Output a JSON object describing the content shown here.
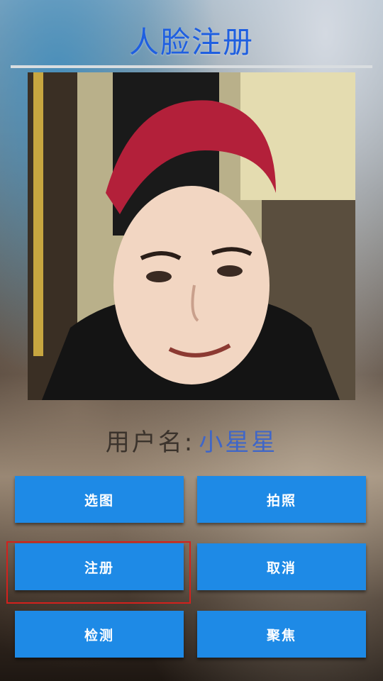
{
  "header": {
    "title": "人脸注册"
  },
  "photo": {
    "subject": "face-photo"
  },
  "user": {
    "label": "用户名:",
    "name": "小星星"
  },
  "buttons": {
    "select_image": "选图",
    "take_photo": "拍照",
    "register": "注册",
    "cancel": "取消",
    "detect": "检测",
    "focus": "聚焦"
  },
  "colors": {
    "title": "#1f5fe0",
    "button": "#1e8ae6",
    "highlight": "#d3211d",
    "username_value": "#3f66c8"
  }
}
